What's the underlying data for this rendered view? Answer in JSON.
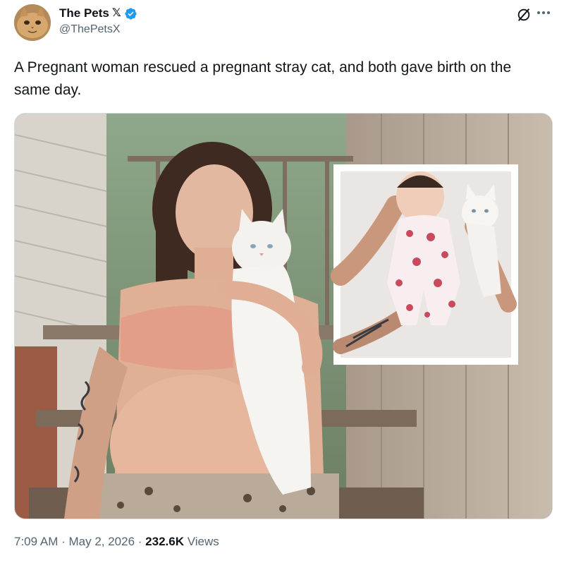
{
  "author": {
    "display_name": "The Pets",
    "x_badge": "𝕏",
    "handle": "@ThePetsX",
    "verified_color": "#1d9bf0"
  },
  "actions": {
    "grok_icon": "grok-icon",
    "more_icon": "more-icon"
  },
  "tweet": {
    "text": "A Pregnant woman rescued a pregnant stray cat, and both gave birth on the same day."
  },
  "media": {
    "kind": "photo"
  },
  "meta": {
    "time": "7:09 AM",
    "separator": " · ",
    "date": "May 2, 2026",
    "views_count": "232.6K",
    "views_label": "Views"
  },
  "colors": {
    "text_primary": "#0f1419",
    "text_secondary": "#536471",
    "border": "#cfd9de"
  }
}
